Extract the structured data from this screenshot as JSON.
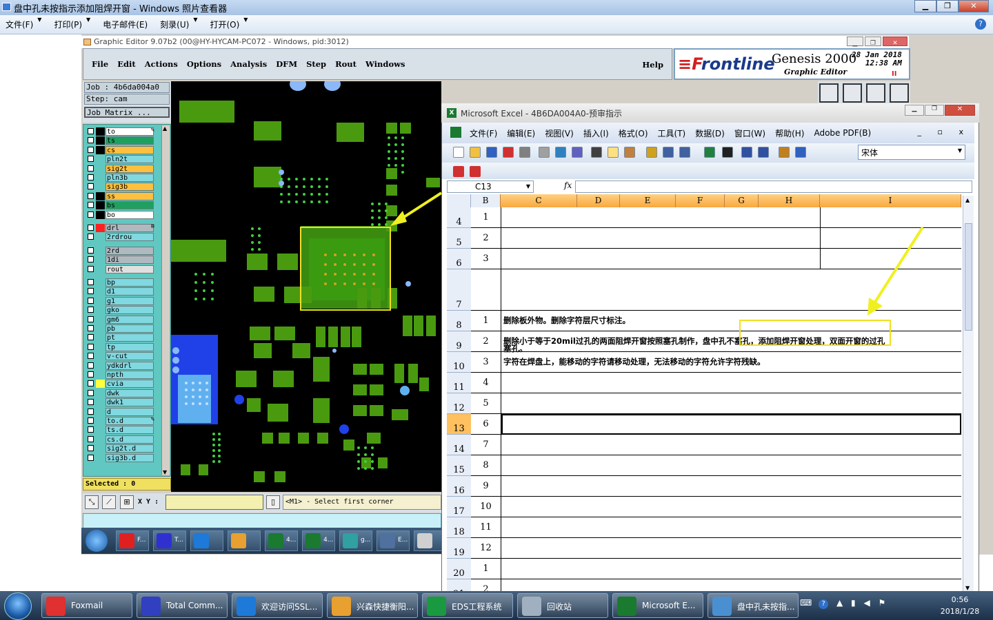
{
  "viewer": {
    "title": "盘中孔未按指示添加阻焊开窗 - Windows 照片查看器",
    "menu": [
      "文件(F)",
      "打印(P)",
      "电子邮件(E)",
      "刻录(U)",
      "打开(O)"
    ],
    "help": "?"
  },
  "ge": {
    "title": "Graphic Editor 9.07b2 (00@HY-HYCAM-PC072 - Windows, pid:3012)",
    "menu": [
      "File",
      "Edit",
      "Actions",
      "Options",
      "Analysis",
      "DFM",
      "Step",
      "Rout",
      "Windows"
    ],
    "help": "Help",
    "brand": {
      "logo_f": "F",
      "logo_rest": "rontline",
      "genesis": "Genesis 2000",
      "subtitle": "Graphic Editor",
      "date": "28 Jan 2018",
      "time": "12:38 AM",
      "pause": "II"
    },
    "job": "Job : 4b6da004a0",
    "step": "Step: cam",
    "job_matrix": "Job Matrix ...",
    "layers": [
      {
        "name": "to",
        "color": "#ffffff",
        "bg": "#ffffff",
        "sw": "#000000",
        "ico": "✎"
      },
      {
        "name": "ts",
        "color": "#20a060",
        "bg": "#20a060",
        "sw": "#000000"
      },
      {
        "name": "cs",
        "color": "#ffc040",
        "bg": "#ffc040",
        "sw": "#000000"
      },
      {
        "name": "pln2t",
        "color": "#60c8d0",
        "bg": "#80d8e0",
        "sw": "#60c8c0"
      },
      {
        "name": "sig2t",
        "color": "#ffc040",
        "bg": "#ffc040",
        "sw": "#60c8c0"
      },
      {
        "name": "pln3b",
        "color": "#60c8d0",
        "bg": "#80d8e0",
        "sw": "#60c8c0"
      },
      {
        "name": "sig3b",
        "color": "#ffc040",
        "bg": "#ffc040",
        "sw": "#60c8c0"
      },
      {
        "name": "ss",
        "color": "#ffc040",
        "bg": "#ffc040",
        "sw": "#000000"
      },
      {
        "name": "bs",
        "color": "#20a060",
        "bg": "#20a060",
        "sw": "#000000"
      },
      {
        "name": "bo",
        "color": "#ffffff",
        "bg": "#ffffff",
        "sw": "#000000"
      },
      {
        "name": "drl",
        "color": "#b0b8c0",
        "bg": "#b0b8c0",
        "sw": "#ff2020",
        "ico": "≡"
      },
      {
        "name": "2rdrou",
        "color": "#80d8e0",
        "bg": "#80d8e0",
        "sw": "#60c8c0"
      },
      {
        "name": "2rd",
        "color": "#b0b8c0",
        "bg": "#b0b8c0",
        "sw": "#60c8c0"
      },
      {
        "name": "1di",
        "color": "#b0b8c0",
        "bg": "#b0b8c0",
        "sw": "#60c8c0"
      },
      {
        "name": "rout",
        "color": "#e0e0e0",
        "bg": "#e0e0e0",
        "sw": "#60c8c0"
      },
      {
        "name": "bp",
        "color": "#80d8e0",
        "bg": "#80d8e0",
        "sw": "#60c8c0"
      },
      {
        "name": "d1",
        "color": "#80d8e0",
        "bg": "#80d8e0",
        "sw": "#60c8c0"
      },
      {
        "name": "g1",
        "color": "#80d8e0",
        "bg": "#80d8e0",
        "sw": "#60c8c0"
      },
      {
        "name": "gko",
        "color": "#80d8e0",
        "bg": "#80d8e0",
        "sw": "#60c8c0"
      },
      {
        "name": "gm6",
        "color": "#80d8e0",
        "bg": "#80d8e0",
        "sw": "#60c8c0"
      },
      {
        "name": "pb",
        "color": "#80d8e0",
        "bg": "#80d8e0",
        "sw": "#60c8c0"
      },
      {
        "name": "pt",
        "color": "#80d8e0",
        "bg": "#80d8e0",
        "sw": "#60c8c0"
      },
      {
        "name": "tp",
        "color": "#80d8e0",
        "bg": "#80d8e0",
        "sw": "#60c8c0"
      },
      {
        "name": "v-cut",
        "color": "#80d8e0",
        "bg": "#80d8e0",
        "sw": "#60c8c0"
      },
      {
        "name": "ydkdrl",
        "color": "#80d8e0",
        "bg": "#80d8e0",
        "sw": "#60c8c0"
      },
      {
        "name": "npth",
        "color": "#80d8e0",
        "bg": "#80d8e0",
        "sw": "#60c8c0"
      },
      {
        "name": "cvia",
        "color": "#80d8e0",
        "bg": "#80d8e0",
        "sw": "#ffff40"
      },
      {
        "name": "dwk",
        "color": "#80d8e0",
        "bg": "#80d8e0",
        "sw": "#60c8c0"
      },
      {
        "name": "dwk1",
        "color": "#80d8e0",
        "bg": "#80d8e0",
        "sw": "#60c8c0"
      },
      {
        "name": "d",
        "color": "#80d8e0",
        "bg": "#80d8e0",
        "sw": "#60c8c0"
      },
      {
        "name": "to.d",
        "color": "#80d8e0",
        "bg": "#80d8e0",
        "sw": "#60c8c0",
        "ico": "✎"
      },
      {
        "name": "ts.d",
        "color": "#80d8e0",
        "bg": "#80d8e0",
        "sw": "#60c8c0"
      },
      {
        "name": "cs.d",
        "color": "#80d8e0",
        "bg": "#80d8e0",
        "sw": "#60c8c0"
      },
      {
        "name": "sig2t.d",
        "color": "#80d8e0",
        "bg": "#80d8e0",
        "sw": "#60c8c0"
      },
      {
        "name": "sig3b.d",
        "color": "#80d8e0",
        "bg": "#80d8e0",
        "sw": "#60c8c0"
      }
    ],
    "selected": "Selected : 0",
    "xy": "X Y :",
    "prompt": "<M1> - Select first corner",
    "shot_tasks": [
      "F...",
      "T...",
      "",
      "",
      "4...",
      "4...",
      "g...",
      "E...",
      ""
    ]
  },
  "excel": {
    "title": "Microsoft Excel - 4B6DA004A0-预审指示",
    "menu": [
      "文件(F)",
      "编辑(E)",
      "视图(V)",
      "插入(I)",
      "格式(O)",
      "工具(T)",
      "数据(D)",
      "窗口(W)",
      "帮助(H)",
      "Adobe PDF(B)"
    ],
    "window_controls": "_ ▫ x",
    "font": "宋体",
    "name_box": "C13",
    "fx": "fx",
    "columns": [
      "B",
      "C",
      "D",
      "E",
      "F",
      "G",
      "H",
      "I"
    ],
    "rows": [
      {
        "n": "4",
        "b": "1",
        "t": ""
      },
      {
        "n": "5",
        "b": "2",
        "t": ""
      },
      {
        "n": "6",
        "b": "3",
        "t": ""
      },
      {
        "n": "7",
        "b": "",
        "t": ""
      },
      {
        "n": "8",
        "b": "1",
        "t": "删除板外物。删除字符层尺寸标注。"
      },
      {
        "n": "9",
        "b": "2",
        "t": "删除小于等于20mil过孔的两面阻焊开窗按照塞孔制作，盘中孔不塞孔，添加阻焊开窗处理，双面开窗的过孔",
        "t2": "塞孔。"
      },
      {
        "n": "10",
        "b": "3",
        "t": "字符在焊盘上，能移动的字符请移动处理，无法移动的字符允许字符残缺。"
      },
      {
        "n": "11",
        "b": "4",
        "t": ""
      },
      {
        "n": "12",
        "b": "5",
        "t": ""
      },
      {
        "n": "13",
        "b": "6",
        "t": ""
      },
      {
        "n": "14",
        "b": "7",
        "t": ""
      },
      {
        "n": "15",
        "b": "8",
        "t": ""
      },
      {
        "n": "16",
        "b": "9",
        "t": ""
      },
      {
        "n": "17",
        "b": "10",
        "t": ""
      },
      {
        "n": "18",
        "b": "11",
        "t": ""
      },
      {
        "n": "19",
        "b": "12",
        "t": ""
      },
      {
        "n": "20",
        "b": "1",
        "t": ""
      },
      {
        "n": "21",
        "b": "2",
        "t": ""
      }
    ]
  },
  "taskbar": {
    "items": [
      "Foxmail",
      "Total Comm...",
      "欢迎访问SSL...",
      "兴森快捷衡阳...",
      "EDS工程系统",
      "回收站",
      "Microsoft E...",
      "盘中孔未按指..."
    ],
    "time": "0:56",
    "date": "2018/1/28"
  }
}
